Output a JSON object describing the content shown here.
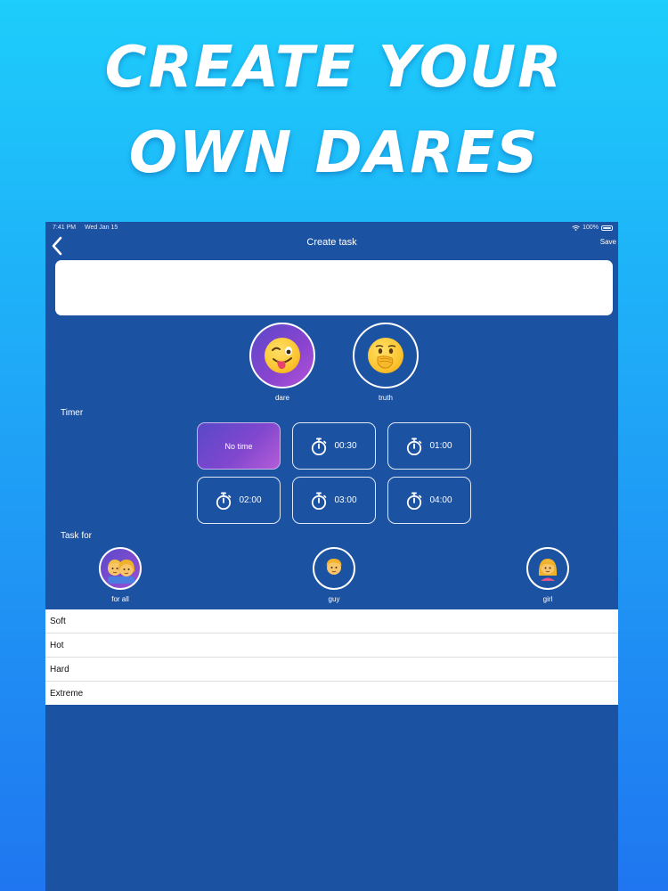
{
  "headline": {
    "line1": "CREATE YOUR",
    "line2": "OWN DARES"
  },
  "status_bar": {
    "time": "7:41 PM",
    "date": "Wed Jan 15",
    "battery": "100%"
  },
  "nav": {
    "title": "Create task",
    "save_label": "Save",
    "back_icon": "chevron-left-icon"
  },
  "task_input": {
    "value": "",
    "placeholder": ""
  },
  "task_types": [
    {
      "label": "dare",
      "icon": "winking-tongue-face-icon",
      "selected": true
    },
    {
      "label": "truth",
      "icon": "face-with-hand-over-mouth-icon",
      "selected": false
    }
  ],
  "timer": {
    "label": "Timer",
    "options": [
      {
        "label": "No time",
        "icon": "",
        "selected": true
      },
      {
        "label": "00:30",
        "icon": "stopwatch-icon",
        "selected": false
      },
      {
        "label": "01:00",
        "icon": "stopwatch-icon",
        "selected": false
      },
      {
        "label": "02:00",
        "icon": "stopwatch-icon",
        "selected": false
      },
      {
        "label": "03:00",
        "icon": "stopwatch-icon",
        "selected": false
      },
      {
        "label": "04:00",
        "icon": "stopwatch-icon",
        "selected": false
      }
    ]
  },
  "task_for": {
    "label": "Task for",
    "options": [
      {
        "label": "for all",
        "icon": "couple-icon",
        "selected": true
      },
      {
        "label": "guy",
        "icon": "man-icon",
        "selected": false
      },
      {
        "label": "girl",
        "icon": "woman-icon",
        "selected": false
      }
    ]
  },
  "levels": [
    "Soft",
    "Hot",
    "Hard",
    "Extreme"
  ],
  "colors": {
    "bg_top": "#1dcdfb",
    "bg_bottom": "#1f76f0",
    "device_bg": "#1c52a2",
    "accent_purple": "#8047ce"
  }
}
